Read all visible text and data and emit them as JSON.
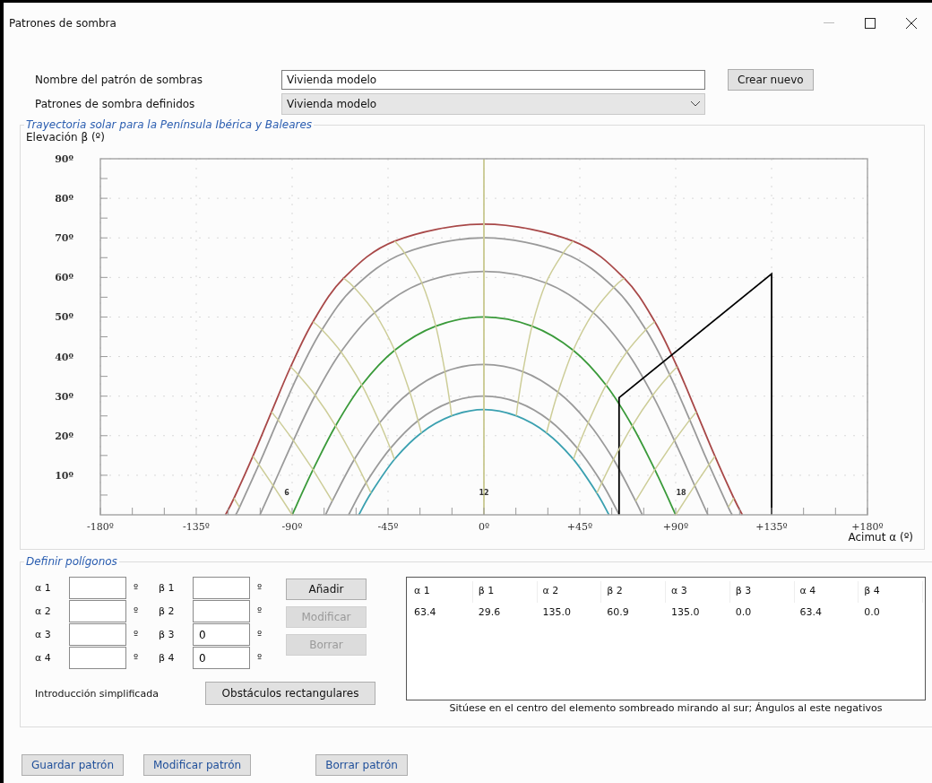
{
  "window": {
    "title": "Patrones de sombra"
  },
  "form": {
    "name_label": "Nombre del patrón de sombras",
    "name_value": "Vivienda modelo",
    "create_button": "Crear nuevo",
    "patterns_label": "Patrones de sombra definidos",
    "patterns_value": "Vivienda modelo"
  },
  "trajectory": {
    "title": "Trayectoria solar para la Península Ibérica y Baleares",
    "chart_data": {
      "type": "line",
      "xlabel": "Acimut α (º)",
      "ylabel": "Elevación β (º)",
      "xlim": [
        -180,
        180
      ],
      "ylim": [
        0,
        90
      ],
      "grid": true,
      "xticks": [
        {
          "value": -180,
          "label": "-180º"
        },
        {
          "value": -135,
          "label": "-135º"
        },
        {
          "value": -90,
          "label": "-90º"
        },
        {
          "value": -45,
          "label": "-45º"
        },
        {
          "value": 0,
          "label": "0º"
        },
        {
          "value": 45,
          "label": "+45º"
        },
        {
          "value": 90,
          "label": "+90º"
        },
        {
          "value": 135,
          "label": "+135º"
        },
        {
          "value": 180,
          "label": "+180º"
        }
      ],
      "yticks": [
        {
          "value": 10,
          "label": "10º"
        },
        {
          "value": 20,
          "label": "20º"
        },
        {
          "value": 30,
          "label": "30º"
        },
        {
          "value": 40,
          "label": "40º"
        },
        {
          "value": 50,
          "label": "50º"
        },
        {
          "value": 60,
          "label": "60º"
        },
        {
          "value": 70,
          "label": "70º"
        },
        {
          "value": 80,
          "label": "80º"
        },
        {
          "value": 90,
          "label": "90º"
        }
      ],
      "series": [
        {
          "color": "#a84848",
          "x": [
            -121.3,
            -117.3,
            -108.4,
            -99.7,
            -90.7,
            -80.2,
            -65.8,
            -41.9,
            0,
            41.9,
            65.8,
            80.2,
            90.7,
            99.7,
            108.4,
            117.3,
            121.3
          ],
          "values": [
            0,
            4.2,
            14.8,
            26.0,
            37.4,
            48.8,
            59.8,
            69.2,
            73.5,
            69.2,
            59.8,
            48.8,
            37.4,
            26.0,
            14.8,
            4.2,
            0
          ]
        },
        {
          "color": "#9a9a9a",
          "x": [
            -116.5,
            -114.7,
            -105.6,
            -96.6,
            -87.2,
            -76.0,
            -60.9,
            -37.2,
            0,
            37.2,
            60.9,
            76.0,
            87.2,
            96.6,
            105.6,
            114.7,
            116.5
          ],
          "values": [
            0,
            1.9,
            12.7,
            24.0,
            35.4,
            46.8,
            57.5,
            66.2,
            70,
            66.2,
            57.5,
            46.8,
            35.4,
            24.0,
            12.7,
            1.9,
            0
          ]
        },
        {
          "color": "#9a9a9a",
          "x": [
            -105.1,
            null,
            -98.9,
            -89.4,
            -79.2,
            -67.1,
            -51.3,
            -29.1,
            0,
            29.1,
            51.3,
            67.1,
            79.2,
            89.4,
            98.9,
            null,
            105.1
          ],
          "values": [
            0,
            null,
            7.4,
            18.8,
            30.2,
            41.2,
            51.1,
            58.6,
            61.5,
            58.6,
            51.1,
            41.2,
            30.2,
            18.8,
            7.4,
            null,
            0
          ]
        },
        {
          "color": "#3a9a3a",
          "x": [
            null,
            null,
            -90,
            -80.2,
            -69.6,
            -57.3,
            -41.9,
            -22.6,
            0,
            22.6,
            41.9,
            57.3,
            69.6,
            80.2,
            90,
            null,
            null
          ],
          "values": [
            null,
            null,
            0,
            11.4,
            22.5,
            32.8,
            41.6,
            47.7,
            50,
            47.7,
            41.6,
            32.8,
            22.5,
            11.4,
            0,
            null,
            null
          ]
        },
        {
          "color": "#9a9a9a",
          "x": [
            -74.3,
            null,
            null,
            -71.2,
            -60.8,
            -48.9,
            -34.8,
            -18.3,
            0,
            18.3,
            34.8,
            48.9,
            60.8,
            71.2,
            null,
            null,
            74.3
          ],
          "values": [
            0,
            null,
            null,
            3.5,
            14.0,
            23.3,
            31.0,
            36.2,
            38,
            36.2,
            31.0,
            23.3,
            14.0,
            3.5,
            null,
            null,
            0
          ]
        },
        {
          "color": "#9a9a9a",
          "x": [
            -63.5,
            null,
            null,
            null,
            -55.3,
            -43.9,
            -30.9,
            -16.0,
            0,
            16.0,
            30.9,
            43.9,
            55.3,
            null,
            null,
            null,
            63.5
          ],
          "values": [
            0,
            null,
            null,
            null,
            8.1,
            16.8,
            23.8,
            28.4,
            30,
            28.4,
            23.8,
            16.8,
            8.1,
            null,
            null,
            null,
            0
          ]
        },
        {
          "color": "#3aa0b0",
          "x": [
            -58.7,
            null,
            null,
            null,
            -53.0,
            -42.0,
            -29.4,
            -15.2,
            0,
            15.2,
            29.4,
            42.0,
            53.0,
            null,
            null,
            null,
            58.7
          ],
          "values": [
            0,
            null,
            null,
            null,
            5.5,
            14.0,
            20.7,
            25.0,
            26.6,
            25.0,
            20.7,
            14.0,
            5.5,
            null,
            null,
            null,
            0
          ]
        },
        {
          "color": "#000000",
          "x": [
            63.4,
            63.4,
            135,
            135
          ],
          "values": [
            0,
            29.6,
            60.9,
            0
          ]
        },
        {
          "color": "#c8c890",
          "x": [
            0,
            0
          ],
          "values": [
            0,
            90
          ]
        }
      ],
      "annotations": [
        "6",
        "12",
        "18"
      ]
    }
  },
  "polygons": {
    "title": "Definir polígonos",
    "fields": [
      {
        "label": "α 1",
        "unit": "º"
      },
      {
        "label": "β 1",
        "unit": "º"
      },
      {
        "label": "α 2",
        "unit": "º"
      },
      {
        "label": "β 2",
        "unit": "º"
      },
      {
        "label": "α 3",
        "unit": "º"
      },
      {
        "label": "β 3",
        "value": "0",
        "unit": "º"
      },
      {
        "label": "α 4",
        "unit": "º"
      },
      {
        "label": "β 4",
        "value": "0",
        "unit": "º"
      }
    ],
    "buttons": [
      {
        "label": "Añadir",
        "disabled": false
      },
      {
        "label": "Modificar",
        "disabled": true
      },
      {
        "label": "Borrar",
        "disabled": true
      }
    ],
    "simplified_label": "Introducción simplificada",
    "rect_button": "Obstáculos rectangulares",
    "table": {
      "columns": [
        "α 1",
        "β 1",
        "α 2",
        "β 2",
        "α 3",
        "β 3",
        "α 4",
        "β 4"
      ],
      "rows": [
        [
          "63.4",
          "29.6",
          "135.0",
          "60.9",
          "135.0",
          "0.0",
          "63.4",
          "0.0"
        ]
      ]
    },
    "note": "Sitúese en el centro del elemento sombreado mirando al sur; Ángulos al este negativos"
  },
  "footer_buttons": [
    "Guardar patrón",
    "Modificar patrón",
    "Borrar patrón"
  ]
}
